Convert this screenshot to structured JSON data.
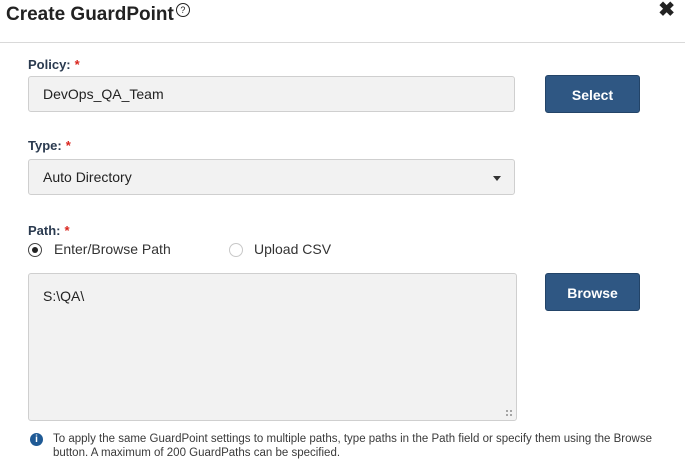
{
  "dialog": {
    "title": "Create GuardPoint",
    "help_glyph": "?",
    "close_glyph": "✖"
  },
  "policy": {
    "label": "Policy:",
    "required_mark": "*",
    "value": "DevOps_QA_Team",
    "select_button": "Select"
  },
  "type": {
    "label": "Type:",
    "required_mark": "*",
    "value": "Auto Directory"
  },
  "path": {
    "label": "Path:",
    "required_mark": "*",
    "options": [
      {
        "label": "Enter/Browse Path",
        "checked": true
      },
      {
        "label": "Upload CSV",
        "checked": false
      }
    ],
    "value": "S:\\QA\\",
    "browse_button": "Browse"
  },
  "info": {
    "glyph": "i",
    "text": "To apply the same GuardPoint settings to multiple paths, type paths in the Path field or specify them using the Browse button. A maximum of 200 GuardPaths can be specified."
  },
  "colors": {
    "accent_button": "#2f5783",
    "required": "#d9241c",
    "info_icon": "#1f5a95"
  }
}
